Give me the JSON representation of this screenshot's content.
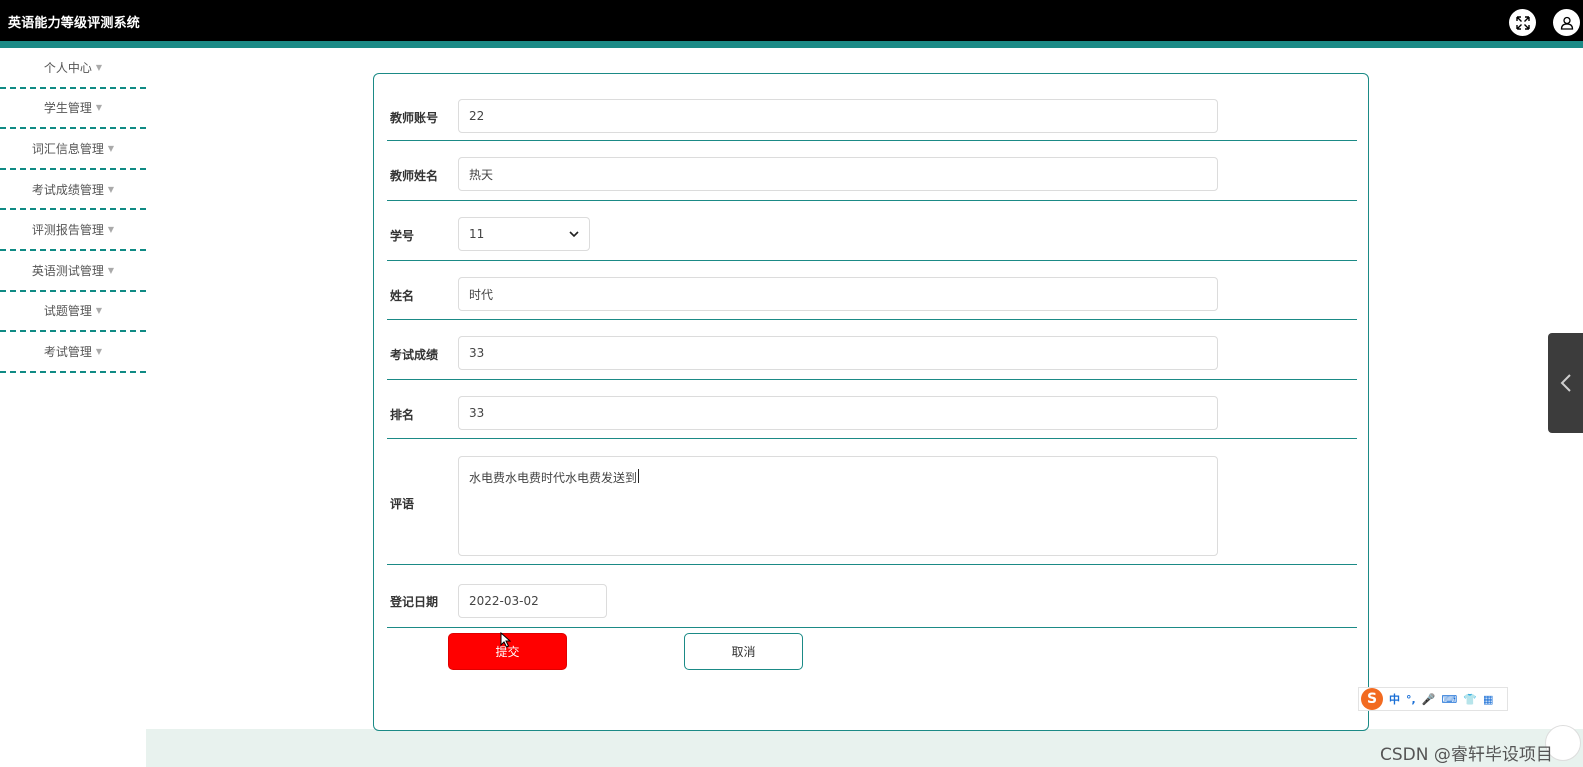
{
  "app": {
    "title": "英语能力等级评测系统"
  },
  "header_icons": {
    "fullscreen": "expand-icon",
    "user": "user-icon"
  },
  "sidebar": {
    "items": [
      {
        "label": "个人中心"
      },
      {
        "label": "学生管理"
      },
      {
        "label": "词汇信息管理"
      },
      {
        "label": "考试成绩管理"
      },
      {
        "label": "评测报告管理"
      },
      {
        "label": "英语测试管理"
      },
      {
        "label": "试题管理"
      },
      {
        "label": "考试管理"
      }
    ]
  },
  "form": {
    "teacher_account": {
      "label": "教师账号",
      "value": "22"
    },
    "teacher_name": {
      "label": "教师姓名",
      "value": "热天"
    },
    "student_id": {
      "label": "学号",
      "value": "11"
    },
    "name": {
      "label": "姓名",
      "value": "时代"
    },
    "score": {
      "label": "考试成绩",
      "value": "33"
    },
    "rank": {
      "label": "排名",
      "value": "33"
    },
    "comment": {
      "label": "评语",
      "value": "水电费水电费时代水电费发送到"
    },
    "register_date": {
      "label": "登记日期",
      "value": "2022-03-02"
    },
    "submit_label": "提交",
    "cancel_label": "取消"
  },
  "ime": {
    "logo": "S",
    "glyphs": [
      "中",
      "°,",
      "🎤",
      "⌨",
      "👕",
      "▦"
    ]
  },
  "watermark": "CSDN @睿轩毕设项目",
  "colors": {
    "topbar": "#000000",
    "accent": "#1b8a86",
    "submit": "#ff0000",
    "footer": "#e8f2ee"
  }
}
